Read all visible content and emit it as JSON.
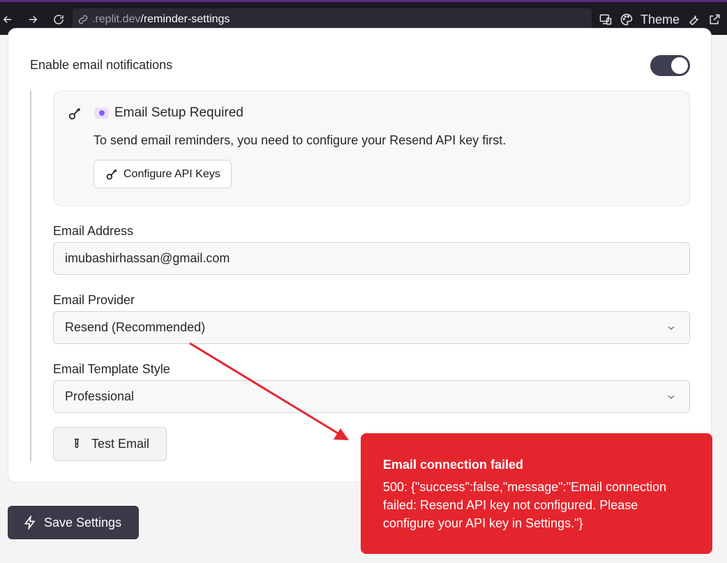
{
  "browser": {
    "url_host": ".replit.dev",
    "url_path": "/reminder-settings",
    "theme_label": "Theme"
  },
  "email_notifications": {
    "label": "Enable email notifications",
    "enabled": true
  },
  "setup": {
    "title": "Email Setup Required",
    "description": "To send email reminders, you need to configure your Resend API key first.",
    "configure_button": "Configure API Keys"
  },
  "fields": {
    "email_address_label": "Email Address",
    "email_address_value": "imubashirhassan@gmail.com",
    "provider_label": "Email Provider",
    "provider_value": "Resend (Recommended)",
    "template_label": "Email Template Style",
    "template_value": "Professional"
  },
  "actions": {
    "test_email": "Test Email",
    "save_settings": "Save Settings"
  },
  "toast": {
    "title": "Email connection failed",
    "message": "500: {\"success\":false,\"message\":\"Email connection failed: Resend API key not configured. Please configure your API key in Settings.\"}",
    "color": "#e5252d"
  },
  "colors": {
    "toggle_on": "#3f3f52",
    "primary_button": "#3a3a48",
    "annotation_arrow": "#e5252d"
  }
}
